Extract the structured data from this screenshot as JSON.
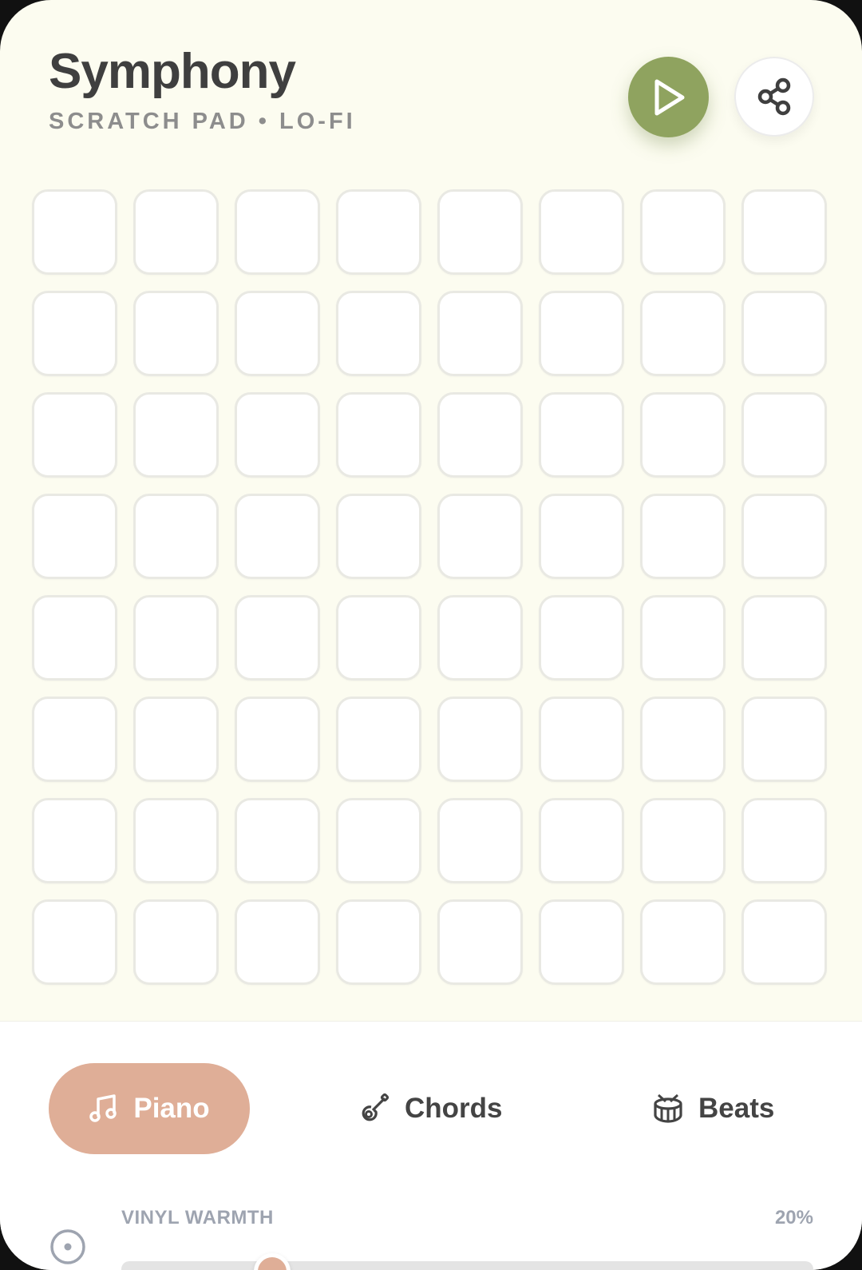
{
  "header": {
    "title": "Symphony",
    "subtitle": "SCRATCH PAD • LO-FI",
    "play_icon": "play-icon",
    "share_icon": "share-icon"
  },
  "pad_grid": {
    "rows": 8,
    "columns": 8,
    "active_pads": []
  },
  "tabs": [
    {
      "label": "Piano",
      "icon": "music-note-icon",
      "active": true
    },
    {
      "label": "Chords",
      "icon": "guitar-icon",
      "active": false
    },
    {
      "label": "Beats",
      "icon": "drum-icon",
      "active": false
    }
  ],
  "warmth": {
    "label": "VINYL WARMTH",
    "value_text": "20%",
    "value": 0.2,
    "icon": "vinyl-disc-icon"
  },
  "colors": {
    "background": "#fcfcf0",
    "play_accent": "#8fa35f",
    "tab_accent": "#dfae97",
    "text_dark": "#3f3f3f",
    "text_muted": "#8d8d8d"
  }
}
